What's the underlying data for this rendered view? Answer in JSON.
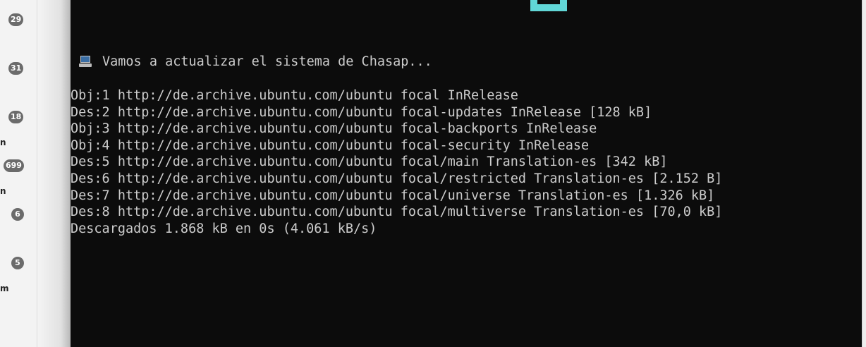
{
  "sidebar": {
    "badges": [
      "29",
      "31",
      "18",
      "699",
      "6",
      "5"
    ],
    "stubs": [
      "n",
      "n",
      "m"
    ]
  },
  "terminal": {
    "header": "Vamos a actualizar el sistema de Chasap...",
    "header_icon": "computer-icon",
    "lines": [
      "Obj:1 http://de.archive.ubuntu.com/ubuntu focal InRelease",
      "Des:2 http://de.archive.ubuntu.com/ubuntu focal-updates InRelease [128 kB]",
      "Obj:3 http://de.archive.ubuntu.com/ubuntu focal-backports InRelease",
      "Obj:4 http://de.archive.ubuntu.com/ubuntu focal-security InRelease",
      "Des:5 http://de.archive.ubuntu.com/ubuntu focal/main Translation-es [342 kB]",
      "Des:6 http://de.archive.ubuntu.com/ubuntu focal/restricted Translation-es [2.152 B]",
      "Des:7 http://de.archive.ubuntu.com/ubuntu focal/universe Translation-es [1.326 kB]",
      "Des:8 http://de.archive.ubuntu.com/ubuntu focal/multiverse Translation-es [70,0 kB]",
      "Descargados 1.868 kB en 0s (4.061 kB/s)"
    ]
  },
  "colors": {
    "terminal_bg": "#0c0c0c",
    "terminal_fg": "#cccccc",
    "ascii_art": "#61d6d6",
    "badge_bg": "#6b6b6b"
  }
}
